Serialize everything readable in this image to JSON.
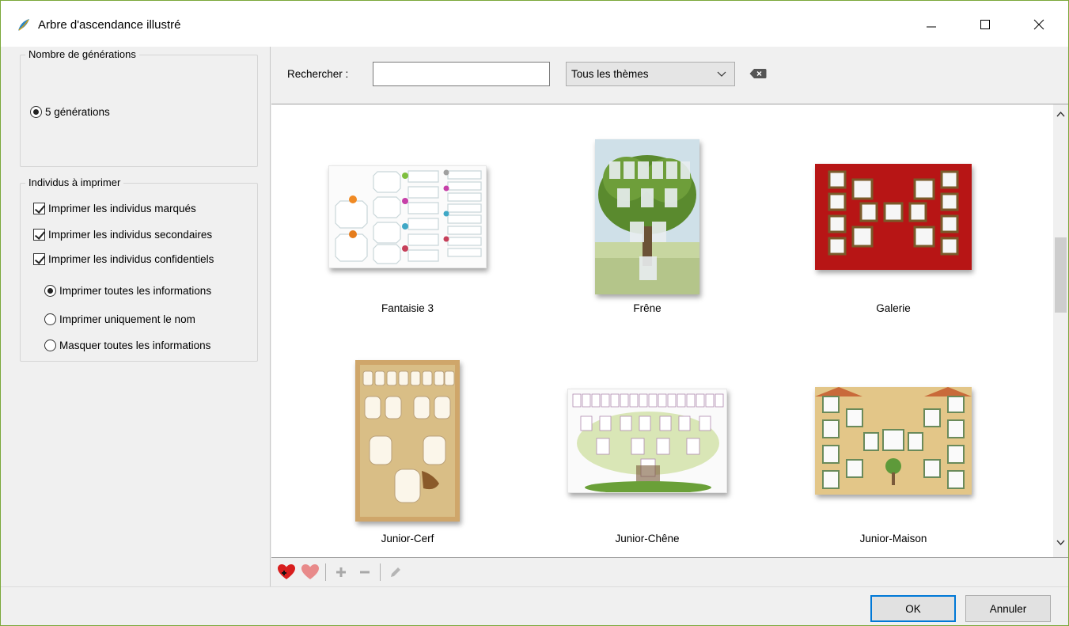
{
  "window": {
    "title": "Arbre d'ascendance illustré",
    "icon": "feather-icon"
  },
  "left": {
    "generations_group": {
      "title": "Nombre de générations",
      "option": "5 générations",
      "selected": true
    },
    "individus_group": {
      "title": "Individus à imprimer",
      "checkboxes": [
        {
          "label": "Imprimer les individus marqués",
          "checked": true
        },
        {
          "label": "Imprimer les individus secondaires",
          "checked": true
        },
        {
          "label": "Imprimer les individus confidentiels",
          "checked": true
        }
      ],
      "radios": [
        {
          "label": "Imprimer toutes les informations",
          "selected": true
        },
        {
          "label": "Imprimer uniquement le nom",
          "selected": false
        },
        {
          "label": "Masquer toutes les informations",
          "selected": false
        }
      ]
    }
  },
  "search": {
    "label": "Rechercher :",
    "value": "",
    "theme_selected": "Tous les thèmes"
  },
  "gallery": {
    "items": [
      {
        "name": "Fantaisie 3"
      },
      {
        "name": "Frêne"
      },
      {
        "name": "Galerie"
      },
      {
        "name": "Junior-Cerf"
      },
      {
        "name": "Junior-Chêne"
      },
      {
        "name": "Junior-Maison"
      }
    ]
  },
  "footer": {
    "ok": "OK",
    "cancel": "Annuler"
  },
  "colors": {
    "accent": "#0078d7",
    "window_border": "#7aa83a",
    "heart_red": "#d81e1e",
    "galerie_red": "#b71515"
  }
}
